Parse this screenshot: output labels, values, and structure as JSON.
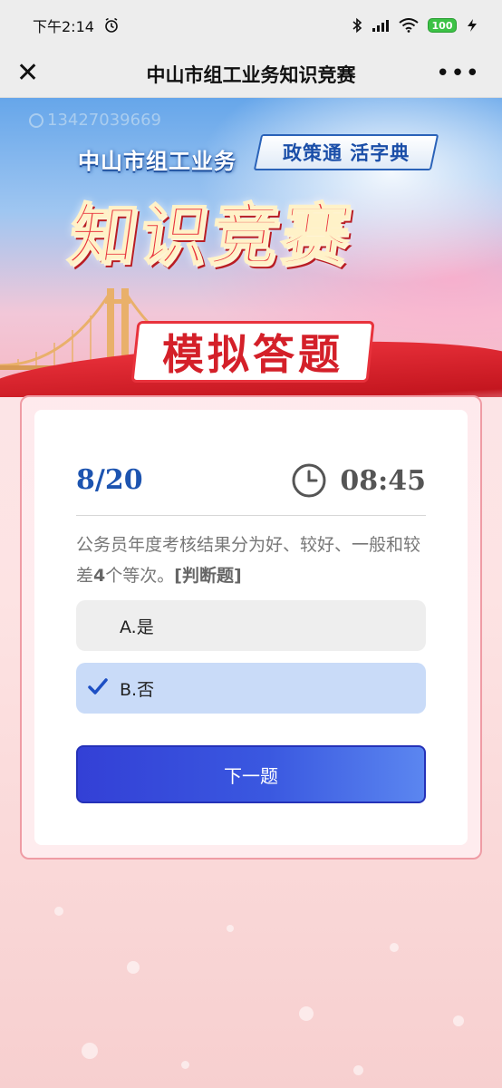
{
  "status_bar": {
    "time": "下午2:14",
    "battery": "100"
  },
  "title_bar": {
    "title": "中山市组工业务知识竞赛",
    "close_icon": "close-icon",
    "more_icon": "more-icon"
  },
  "banner": {
    "phone": "13427039669",
    "subtitle": "中山市组工业务",
    "badge": "政策通 活字典",
    "main_title": "知识竞赛",
    "tag": "模拟答题"
  },
  "quiz": {
    "progress": "8/20",
    "timer": "08:45",
    "question_part1": "公务员年度考核结果分为好、较好、一般和较差",
    "question_num": "4",
    "question_part2": "个等次。",
    "question_type": "[判断题]",
    "options": [
      {
        "label": "A.是",
        "selected": false
      },
      {
        "label": "B.否",
        "selected": true
      }
    ],
    "next_label": "下一题"
  },
  "colors": {
    "accent": "#1d54b0",
    "button": "#3a58e0",
    "selected_option": "#c9dbf8",
    "card_border": "#ef9ca5"
  }
}
